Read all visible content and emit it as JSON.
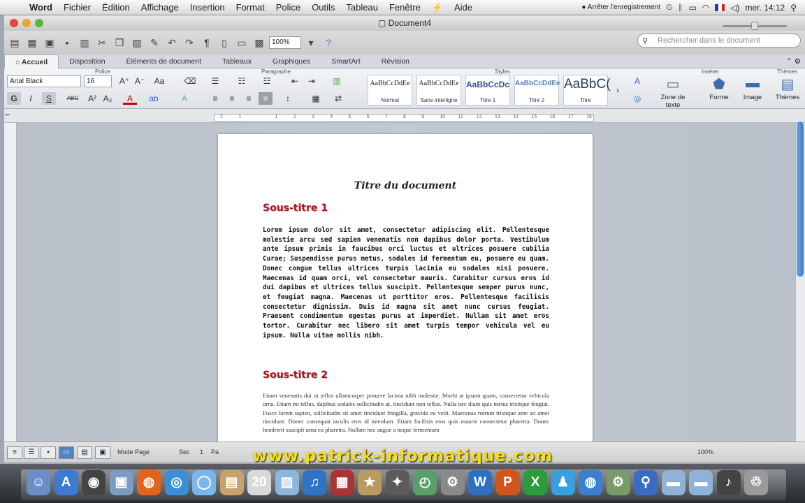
{
  "menubar": {
    "app": "Word",
    "items": [
      "Fichier",
      "Édition",
      "Affichage",
      "Insertion",
      "Format",
      "Police",
      "Outils",
      "Tableau",
      "Fenêtre"
    ],
    "script_icon": "script-icon",
    "help": "Aide",
    "recording": "Arrêter l'enregistrement",
    "clock": "mer. 14:12"
  },
  "window": {
    "title": "Document4",
    "zoom": "100%",
    "search_placeholder": "Rechercher dans le document"
  },
  "ribbon": {
    "tabs": [
      "Accueil",
      "Disposition",
      "Éléments de document",
      "Tableaux",
      "Graphiques",
      "SmartArt",
      "Révision"
    ],
    "groups": {
      "font": "Police",
      "paragraph": "Paragraphe",
      "styles": "Styles",
      "insert": "Insérer",
      "themes": "Thèmes"
    },
    "font_name": "Arial Black",
    "font_size": "16",
    "styles": [
      {
        "preview": "AaBbCcDdEe",
        "name": "Normal"
      },
      {
        "preview": "AaBbCcDdEe",
        "name": "Sans interligne"
      },
      {
        "preview": "AaBbCcDc",
        "name": "Titre 1"
      },
      {
        "preview": "AaBbCcDdEe",
        "name": "Titre 2"
      },
      {
        "preview": "AaBbC(",
        "name": "Titre"
      }
    ],
    "insert": {
      "textbox": "Zone de texte",
      "shape": "Forme",
      "image": "Image"
    },
    "themes": "Thèmes"
  },
  "ruler_ticks": [
    "2",
    "1",
    "",
    "1",
    "2",
    "3",
    "4",
    "5",
    "6",
    "7",
    "8",
    "9",
    "10",
    "11",
    "12",
    "13",
    "14",
    "15",
    "16",
    "17",
    "18"
  ],
  "document": {
    "title": "Titre du document",
    "subtitle1": "Sous-titre 1",
    "para1": "Lorem ipsum dolor sit amet, consectetur adipiscing elit. Pellentesque molestie arcu sed sapien venenatis non dapibus dolor porta. Vestibulum ante ipsum primis in faucibus orci luctus et ultrices posuere cubilia Curae; Suspendisse purus metus, sodales id fermentum eu, posuere eu quam. Donec congue tellus ultrices turpis lacinia eu sodales nisi posuere. Maecenas id quam orci, vel consectetur mauris. Curabitur cursus eros id dui dapibus et ultrices tellus suscipit. Pellentesque semper purus nunc, et feugiat magna. Maecenas ut porttitor eros. Pellentesque facilisis consectetur dignissim. Duis id magna sit amet nunc cursus feugiat. Praesent condimentum egestas purus at imperdiet. Nullam sit amet eros tortor. Curabitur nec libero sit amet turpis tempor vehicula vel eu ipsum. Nulla vitae mollis nibh.",
    "subtitle2": "Sous-titre 2",
    "para2": "Etiam venenatis dui ut tellus ullamcorper posuere lacinia nibh molestie. Morbi at ipsum quam, consectetur vehicula urna. Etiam mi tellus, dapibus sodales sollicitudin ut, tincidunt non tellus. Nulla nec diam quis metus tristique feugiat. Fusce lorem sapien, sollicitudin sit amet tincidunt fringilla, gravida eu velit. Maecenas rutrum tristique ante sit amet tincidunt. Donec consequat iaculis eros id interdum. Etiam facilisis eros quis mauris consectetur pharetra. Donec hendrerit suscipit urna eu pharetra. Nullam nec augue a neque fermentum"
  },
  "statusbar": {
    "view": "Mode Page",
    "section_label": "Sec",
    "section_value": "1",
    "page_abbr": "Pa",
    "zoom": "100%",
    "zoom_level": 0.5
  },
  "watermark": "www.patrick-informatique.com",
  "dock": [
    "Finder",
    "App Store",
    "Préférences",
    "Aperçu",
    "Firefox",
    "Safari",
    "iChat",
    "Archive",
    "iCal",
    "iPhoto",
    "iTunes",
    "Photo Booth",
    "Garage",
    "iMovie",
    "Time Machine",
    "Préférences système",
    "Word",
    "PowerPoint",
    "Excel",
    "Messenger",
    "Réseau",
    "Utilitaire",
    "Recherche",
    "Dossier",
    "Documents",
    "Musique",
    "Corbeille"
  ],
  "colors": {
    "accent": "#3d7cc8",
    "heading": "#b3121a",
    "watermark": "#f5df19"
  }
}
